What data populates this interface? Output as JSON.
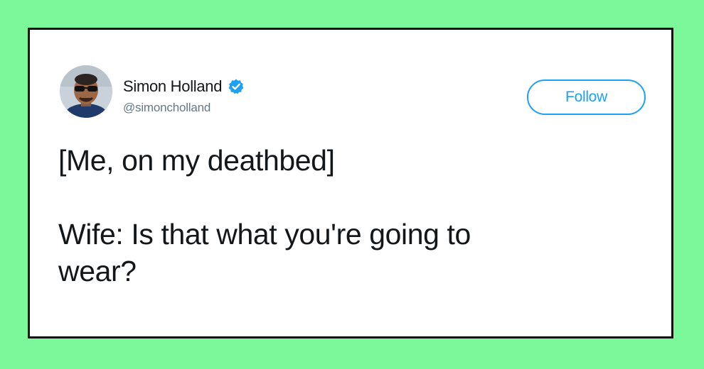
{
  "page": {
    "background_color": "#7cf89b",
    "card_border_color": "#111111"
  },
  "tweet": {
    "author": {
      "display_name": "Simon Holland",
      "handle": "@simoncholland",
      "verified": true,
      "verified_icon": "verified-badge-icon",
      "verified_color": "#1da1f2",
      "avatar_icon": "profile-photo"
    },
    "follow_button": {
      "label": "Follow",
      "color": "#1da1f2"
    },
    "text": {
      "line1": "[Me, on my deathbed]",
      "line2": "Wife: Is that what you're going to",
      "line3": "wear?"
    }
  }
}
